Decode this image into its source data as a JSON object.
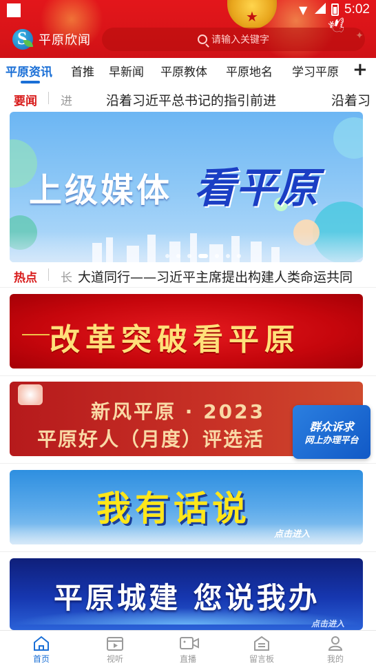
{
  "status_bar": {
    "time": "5:02"
  },
  "header": {
    "app_name": "平原欣闻",
    "search_placeholder": "请输入关键字"
  },
  "category_tabs": [
    {
      "label": "平原资讯",
      "active": true
    },
    {
      "label": "首推"
    },
    {
      "label": "早新闻"
    },
    {
      "label": "平原教体"
    },
    {
      "label": "平原地名"
    },
    {
      "label": "学习平原"
    }
  ],
  "add_tab_label": "+",
  "ticker_top": {
    "tag": "要闻",
    "prev_fragment": "进",
    "headline": "沿着习近平总书记的指引前进",
    "next_fragment": "沿着习"
  },
  "carousel": {
    "title_part1": "上级媒体",
    "title_part2": "看平原",
    "page_count": 7,
    "active_page": 4
  },
  "ticker_hot": {
    "tag": "热点",
    "prev_fragment": "长",
    "headline": "大道同行——习近平主席提出构建人类命运共同"
  },
  "banners": {
    "reform": "改革突破看平原",
    "haoren_line1": "新风平原 · 2023",
    "haoren_line2": "平原好人（月度）评选活",
    "speak": "我有话说",
    "speak_hint": "点击进入",
    "city": "平原城建 您说我办",
    "city_hint": "点击进入"
  },
  "float_button": {
    "line1": "群众诉求",
    "line2": "网上办理平台"
  },
  "bottom_nav": [
    {
      "label": "首页",
      "icon": "home-icon",
      "active": true
    },
    {
      "label": "视听",
      "icon": "video-icon"
    },
    {
      "label": "直播",
      "icon": "camera-icon"
    },
    {
      "label": "留言板",
      "icon": "message-board-icon"
    },
    {
      "label": "我的",
      "icon": "user-icon"
    }
  ],
  "colors": {
    "brand_red": "#e3161b",
    "accent_blue": "#1a6fd6",
    "tag_red": "#d81b1b"
  }
}
